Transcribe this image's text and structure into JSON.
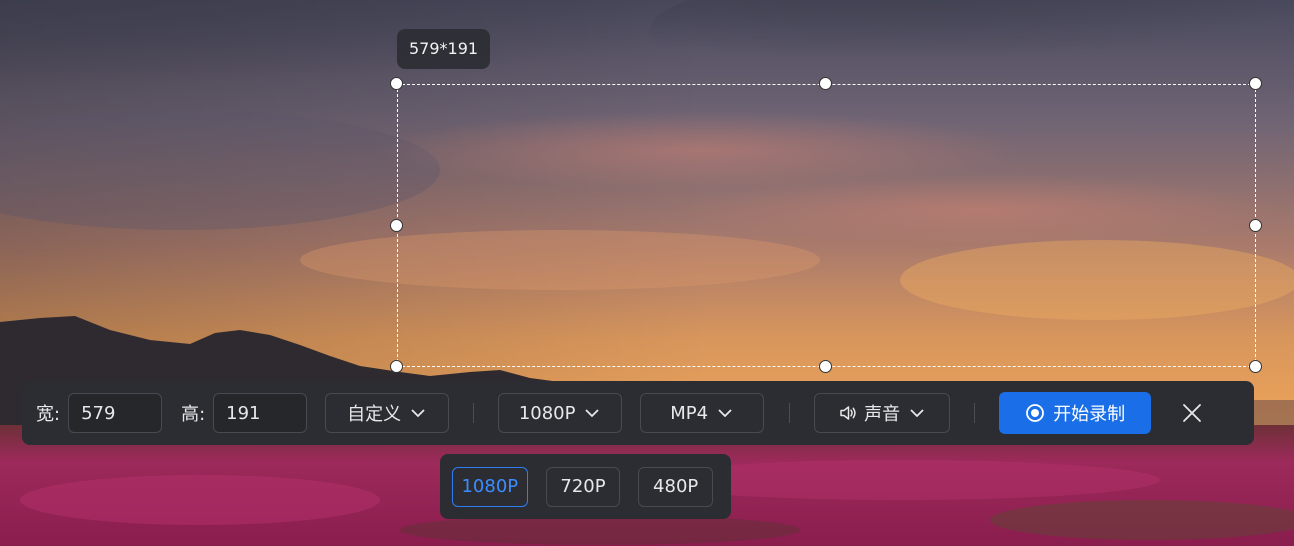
{
  "selection": {
    "size_label": "579*191"
  },
  "toolbar": {
    "width_label": "宽:",
    "width_value": "579",
    "height_label": "高:",
    "height_value": "191",
    "area_mode": "自定义",
    "resolution": "1080P",
    "format": "MP4",
    "audio": "声音",
    "start_label": "开始录制"
  },
  "resolution_menu": {
    "options": [
      {
        "label": "1080P",
        "selected": true
      },
      {
        "label": "720P",
        "selected": false
      },
      {
        "label": "480P",
        "selected": false
      }
    ]
  },
  "colors": {
    "accent": "#1a6ee8",
    "toolbar_bg": "#2b2d32",
    "selected_option": "#3c8cff"
  },
  "icons": {
    "dropdown": "chevron-down-icon",
    "audio": "speaker-icon",
    "record": "record-icon",
    "close": "close-icon"
  }
}
